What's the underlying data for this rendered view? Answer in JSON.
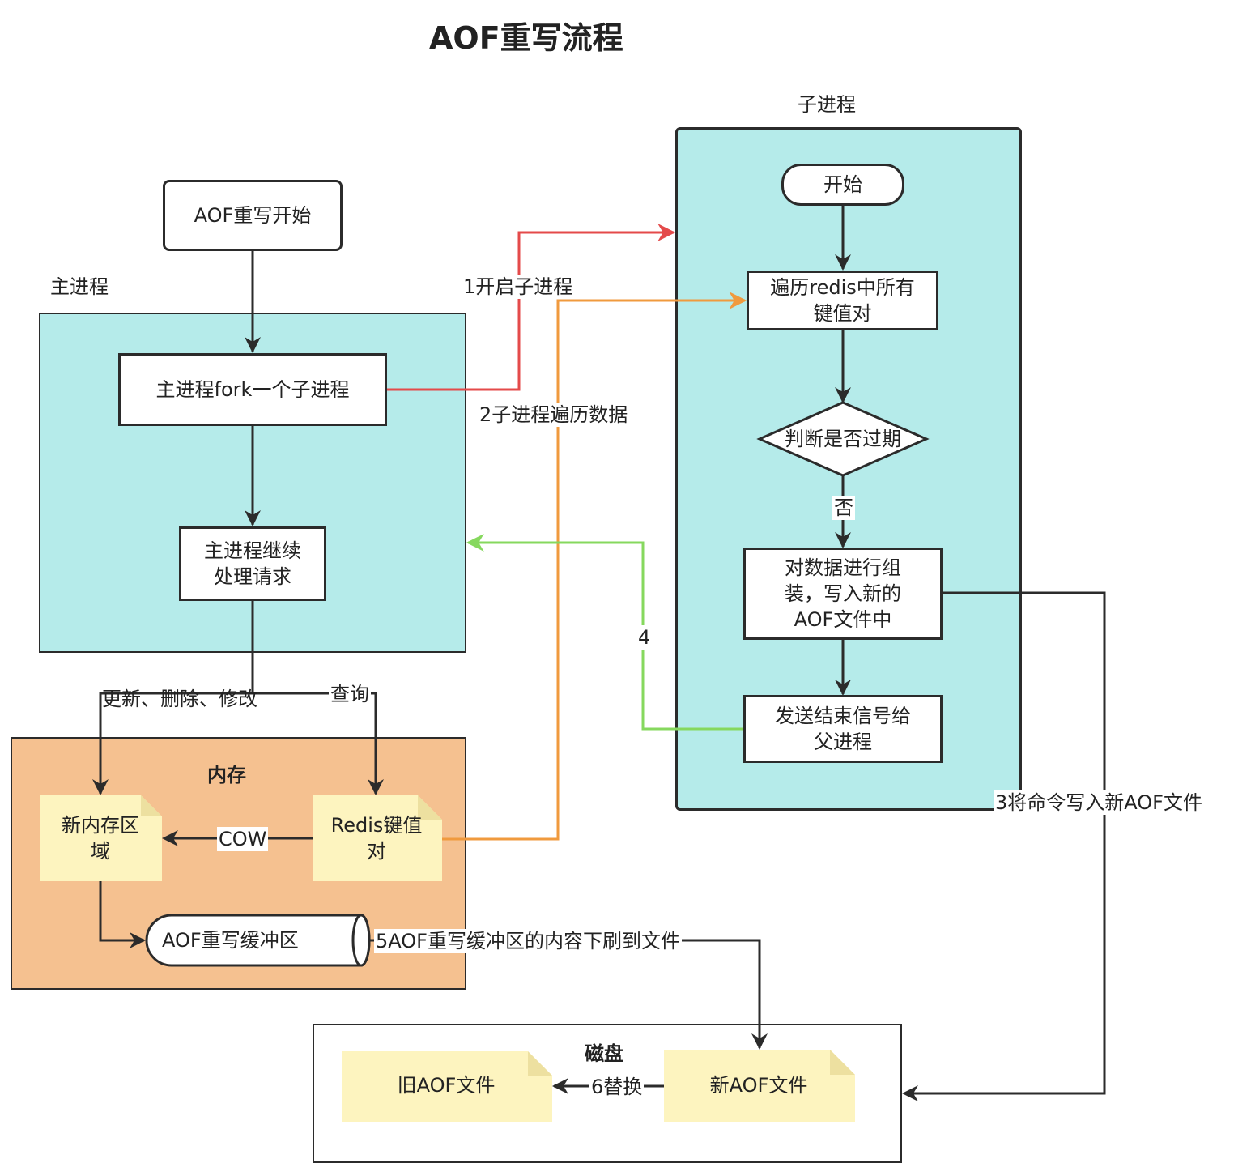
{
  "title": "AOF重写流程",
  "zones": {
    "main_process": "主进程",
    "child_process": "子进程",
    "memory": "内存",
    "disk": "磁盘"
  },
  "nodes": {
    "aof_rewrite_start": "AOF重写开始",
    "main_fork": "主进程fork一个子进程",
    "main_continue": "主进程继续\n处理请求",
    "child_start": "开始",
    "child_traverse": "遍历redis中所有\n键值对",
    "child_check_expired": "判断是否过期",
    "child_assemble": "对数据进行组\n装，写入新的\nAOF文件中",
    "child_signal": "发送结束信号给\n父进程",
    "new_memory_region": "新内存区\n域",
    "redis_kv": "Redis键值\n对",
    "aof_rewrite_buffer": "AOF重写缓冲区",
    "old_aof_file": "旧AOF文件",
    "new_aof_file": "新AOF文件"
  },
  "edge_labels": {
    "step1": "1开启子进程",
    "step2": "2子进程遍历数据",
    "step3": "3将命令写入新AOF文件",
    "step4": "4",
    "step5": "5AOF重写缓冲区的内容下刷到文件",
    "step6": "6替换",
    "no": "否",
    "cow": "COW",
    "update": "更新、删除、修改",
    "query": "查询"
  },
  "colors": {
    "process_bg": "#b5ebea",
    "memory_bg": "#f5c190",
    "note_bg": "#fdf4bf",
    "note_fold": "#ede0a0",
    "line_dark": "#2b2b2b",
    "line_red": "#e44a4a",
    "line_orange": "#f09a3e",
    "line_green": "#86d85e"
  }
}
